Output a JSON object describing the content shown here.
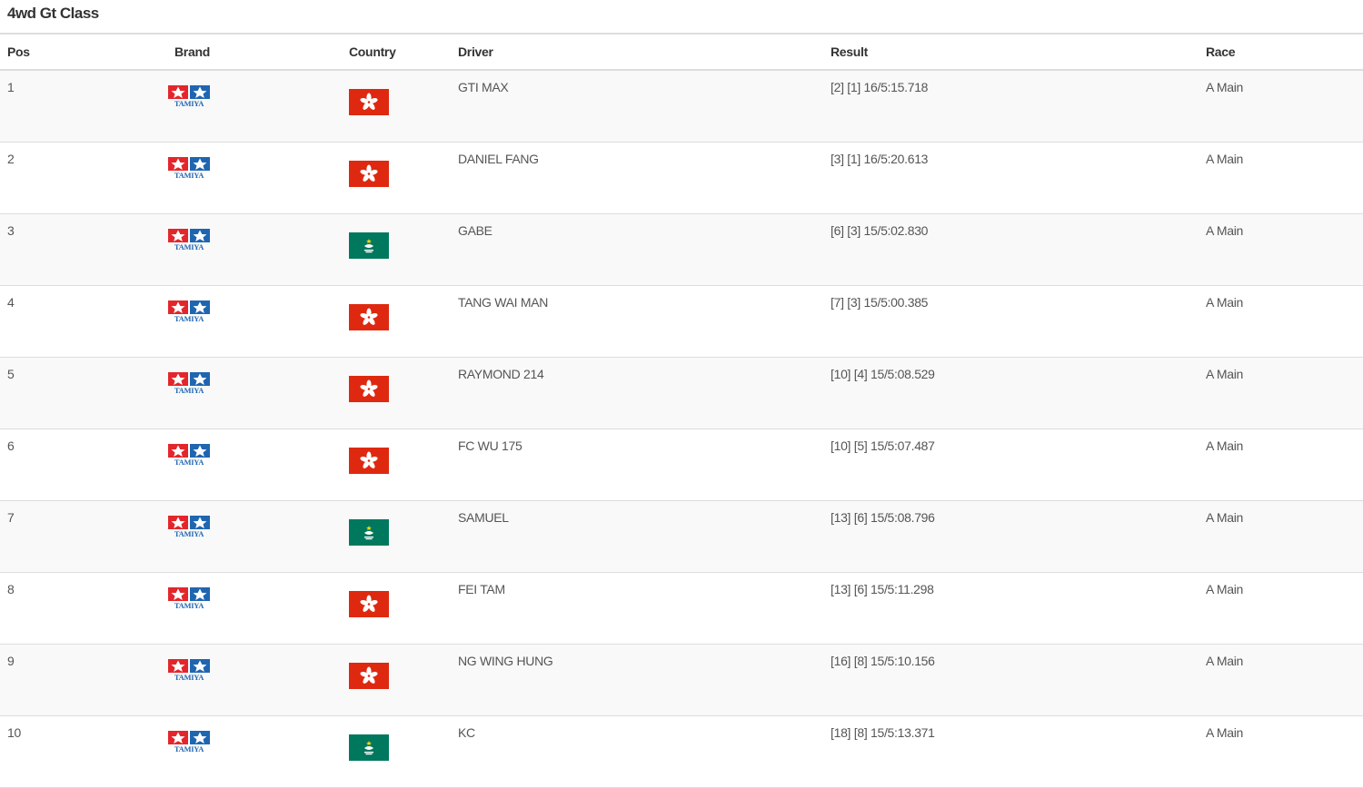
{
  "title": "4wd Gt Class",
  "columns": {
    "pos": "Pos",
    "brand": "Brand",
    "country": "Country",
    "driver": "Driver",
    "result": "Result",
    "race": "Race"
  },
  "brand_logo_text": "TAMIYA",
  "colors": {
    "hk_red": "#de2910",
    "macau_green": "#00785e",
    "tamiya_red": "#e3262b",
    "tamiya_blue": "#1f66b1",
    "row_stripe": "#f9f9f9",
    "border": "#dddddd"
  },
  "rows": [
    {
      "pos": "1",
      "brand": "tamiya-logo",
      "country": "hong-kong-flag",
      "driver": "GTI MAX",
      "result": "[2] [1] 16/5:15.718",
      "race": "A Main"
    },
    {
      "pos": "2",
      "brand": "tamiya-logo",
      "country": "hong-kong-flag",
      "driver": "DANIEL FANG",
      "result": "[3] [1] 16/5:20.613",
      "race": "A Main"
    },
    {
      "pos": "3",
      "brand": "tamiya-logo",
      "country": "macau-flag",
      "driver": "GABE",
      "result": "[6] [3] 15/5:02.830",
      "race": "A Main"
    },
    {
      "pos": "4",
      "brand": "tamiya-logo",
      "country": "hong-kong-flag",
      "driver": "TANG WAI MAN",
      "result": "[7] [3] 15/5:00.385",
      "race": "A Main"
    },
    {
      "pos": "5",
      "brand": "tamiya-logo",
      "country": "hong-kong-flag",
      "driver": "RAYMOND 214",
      "result": "[10] [4] 15/5:08.529",
      "race": "A Main"
    },
    {
      "pos": "6",
      "brand": "tamiya-logo",
      "country": "hong-kong-flag",
      "driver": "FC WU 175",
      "result": "[10] [5] 15/5:07.487",
      "race": "A Main"
    },
    {
      "pos": "7",
      "brand": "tamiya-logo",
      "country": "macau-flag",
      "driver": "SAMUEL",
      "result": "[13] [6] 15/5:08.796",
      "race": "A Main"
    },
    {
      "pos": "8",
      "brand": "tamiya-logo",
      "country": "hong-kong-flag",
      "driver": "FEI TAM",
      "result": "[13] [6] 15/5:11.298",
      "race": "A Main"
    },
    {
      "pos": "9",
      "brand": "tamiya-logo",
      "country": "hong-kong-flag",
      "driver": "NG WING HUNG",
      "result": "[16] [8] 15/5:10.156",
      "race": "A Main"
    },
    {
      "pos": "10",
      "brand": "tamiya-logo",
      "country": "macau-flag",
      "driver": "KC",
      "result": "[18] [8] 15/5:13.371",
      "race": "A Main"
    }
  ]
}
